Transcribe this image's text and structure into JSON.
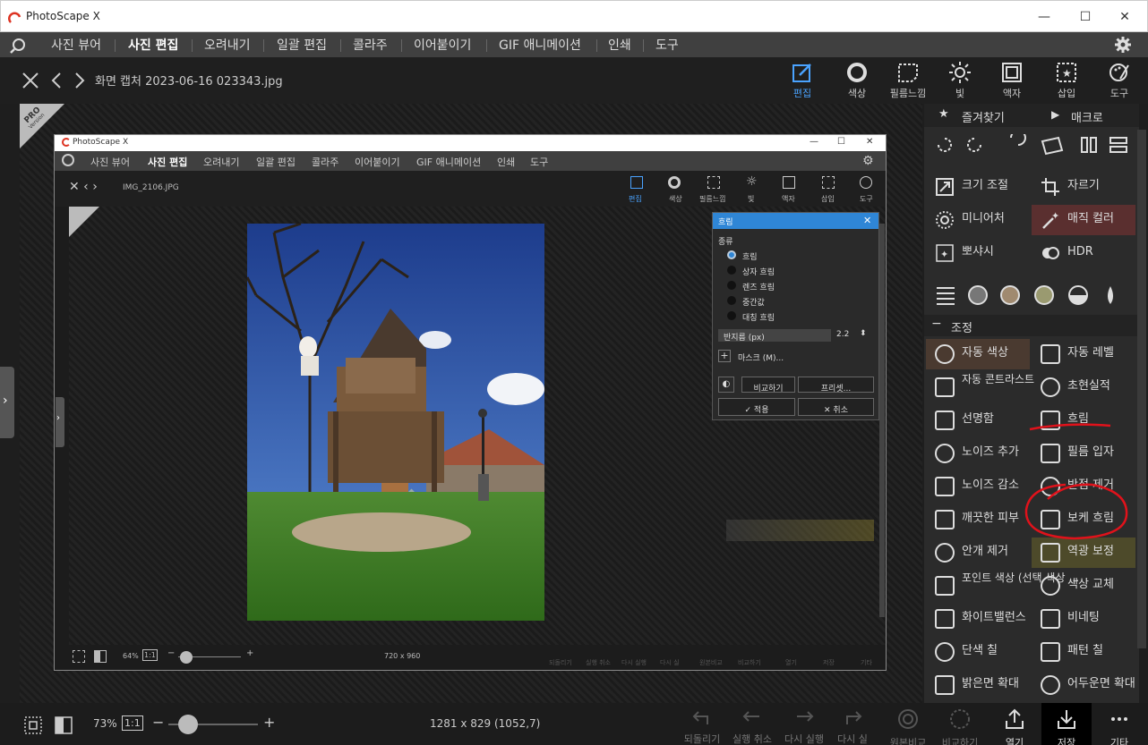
{
  "app": {
    "title": "PhotoScape X",
    "win_min": "—",
    "win_max": "☐",
    "win_close": "✕"
  },
  "menu": {
    "items": [
      "사진 뷰어",
      "사진 편집",
      "오려내기",
      "일괄 편집",
      "콜라주",
      "이어붙이기",
      "GIF 애니메이션",
      "인쇄",
      "도구"
    ],
    "active": "사진 편집"
  },
  "file": {
    "name": "화면 캡처 2023-06-16 023343.jpg"
  },
  "toolbar": {
    "tabs": [
      "편집",
      "색상",
      "필름느낌",
      "빛",
      "액자",
      "삽입",
      "도구"
    ],
    "active": "편집"
  },
  "badge": {
    "pro": "PRO",
    "version": "Version"
  },
  "inner": {
    "title": "PhotoScape X",
    "menu": [
      "사진 뷰어",
      "사진 편집",
      "오려내기",
      "일괄 편집",
      "콜라주",
      "이어붙이기",
      "GIF 애니메이션",
      "인쇄",
      "도구"
    ],
    "file": "IMG_2106.JPG",
    "tabs": [
      "편집",
      "색상",
      "필름느낌",
      "빛",
      "액자",
      "삽입",
      "도구"
    ],
    "zoom": "64%",
    "one_to_one": "1:1",
    "dims": "720 x 960",
    "bottom": [
      "되돌리기",
      "실행 취소",
      "다시 실행",
      "다시 실",
      "원본비교",
      "비교하기",
      "열기",
      "저장",
      "기타"
    ]
  },
  "dialog": {
    "title": "흐림",
    "section": "종류",
    "options": [
      "흐림",
      "상자 흐림",
      "렌즈 흐림",
      "중간값",
      "대칭 흐림"
    ],
    "selected": 0,
    "radius_label": "반지름 (px)",
    "radius_value": "2.2",
    "mask": "마스크 (M)...",
    "compare": "비교하기",
    "preset": "프리셋...",
    "apply": "적용",
    "cancel": "취소"
  },
  "right": {
    "favorites": "즐겨찾기",
    "macro": "매크로",
    "tools": [
      {
        "label": "크기 조절",
        "icon": "resize-icon"
      },
      {
        "label": "자르기",
        "icon": "crop-icon"
      },
      {
        "label": "미니어처",
        "icon": "miniature-icon"
      },
      {
        "label": "매직 컬러",
        "icon": "magic-wand-icon"
      },
      {
        "label": "뽀샤시",
        "icon": "sparkle-icon"
      },
      {
        "label": "HDR",
        "icon": "hdr-icon"
      }
    ],
    "section_adjust": "조정",
    "adjust": [
      {
        "label": "자동 색상",
        "icon": "auto-color-icon"
      },
      {
        "label": "자동 레벨",
        "icon": "auto-level-icon"
      },
      {
        "label": "자동 콘트라스트",
        "icon": "auto-contrast-icon"
      },
      {
        "label": "초현실적",
        "icon": "surreal-icon"
      },
      {
        "label": "선명함",
        "icon": "sharpen-icon"
      },
      {
        "label": "흐림",
        "icon": "blur-drop-icon"
      },
      {
        "label": "노이즈 추가",
        "icon": "add-noise-icon"
      },
      {
        "label": "필름 입자",
        "icon": "film-grain-icon"
      },
      {
        "label": "노이즈 감소",
        "icon": "denoise-icon"
      },
      {
        "label": "반점 제거",
        "icon": "despeckle-icon"
      },
      {
        "label": "깨끗한 피부",
        "icon": "clean-skin-icon"
      },
      {
        "label": "보케 흐림",
        "icon": "bokeh-icon"
      },
      {
        "label": "안개 제거",
        "icon": "dehaze-icon"
      },
      {
        "label": "역광 보정",
        "icon": "backlight-icon"
      },
      {
        "label": "포인트 색상 (선택 색상 …",
        "icon": "point-color-icon"
      },
      {
        "label": "색상 교체",
        "icon": "replace-color-icon"
      },
      {
        "label": "화이트밸런스",
        "icon": "white-balance-icon"
      },
      {
        "label": "비네팅",
        "icon": "vignette-icon"
      },
      {
        "label": "단색 칠",
        "icon": "solid-fill-icon"
      },
      {
        "label": "패턴 칠",
        "icon": "pattern-fill-icon"
      },
      {
        "label": "밝은면 확대",
        "icon": "expand-light-icon"
      },
      {
        "label": "어두운면 확대",
        "icon": "expand-dark-icon"
      }
    ]
  },
  "status": {
    "zoom": "73%",
    "one_to_one": "1:1",
    "dims": "1281 x 829 (1052,7)"
  },
  "bottom": {
    "undo_all": "되돌리기",
    "undo": "실행 취소",
    "redo": "다시 실행",
    "redo_all": "다시 실",
    "compare_orig": "원본비교",
    "compare": "비교하기",
    "open": "열기",
    "save": "저장",
    "more": "기타"
  },
  "colors": {
    "accent": "#2f86d6",
    "annotation": "#e0121b",
    "panel": "#2b2b2b"
  }
}
